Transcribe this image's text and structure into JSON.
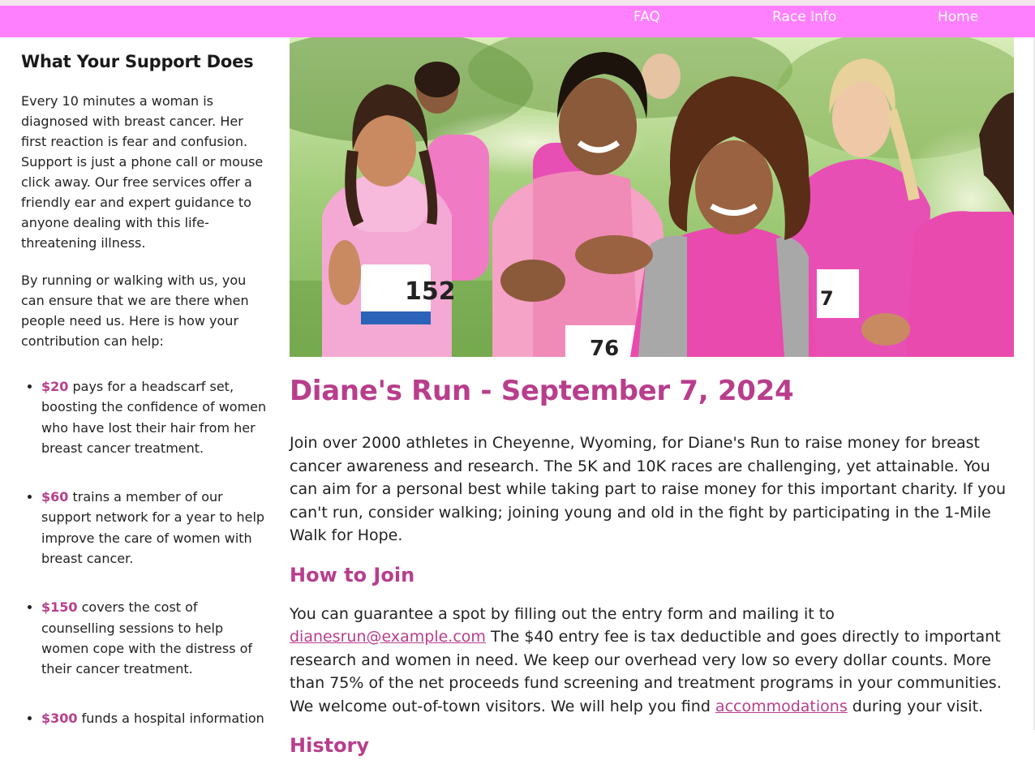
{
  "nav": {
    "items": [
      "FAQ",
      "Race Info",
      "Home"
    ]
  },
  "sidebar": {
    "heading": "What Your Support Does",
    "paragraphs": [
      "Every 10 minutes a woman is diagnosed with breast cancer. Her first reaction is fear and confusion. Support is just a phone call or mouse click away. Our free services offer a friendly ear and expert guidance to anyone dealing with this life-threatening illness.",
      "By running or walking with us, you can ensure that we are there when people need us. Here is how your contribution can help:"
    ],
    "contributions": [
      {
        "amount": "$20",
        "text": " pays for a headscarf set, boosting the confidence of women who have lost their hair from her breast cancer treatment."
      },
      {
        "amount": "$60",
        "text": " trains a member of our support network for a year to help improve the care of women with breast cancer."
      },
      {
        "amount": "$150",
        "text": " covers the cost of counselling sessions to help women cope with the distress of their cancer treatment."
      },
      {
        "amount": "$300",
        "text": " funds a hospital information"
      }
    ]
  },
  "hero": {
    "alt": "Women in pink running a race",
    "bib_numbers": [
      "152",
      "76",
      "7"
    ]
  },
  "main": {
    "title": "Diane's Run - September 7, 2024",
    "intro": "Join over 2000 athletes in Cheyenne, Wyoming, for Diane's Run to raise money for breast cancer awareness and research. The 5K and 10K races are challenging, yet attainable. You can aim for a personal best while taking part to raise money for this important charity. If you can't run, consider walking; joining young and old in the fight by participating in the 1-Mile Walk for Hope.",
    "how_to_join_heading": "How to Join",
    "join_text_before": "You can guarantee a spot by filling out the entry form and mailing it to ",
    "join_email": "dianesrun@example.com",
    "join_text_middle": " The $40 entry fee is tax deductible and goes directly to important research and women in need. We keep our overhead very low so every dollar counts. More than 75% of the net proceeds fund screening and treatment programs in your communities. We welcome out-of-town visitors. We will help you find ",
    "join_link": "accommodations",
    "join_text_after": " during your visit.",
    "history_heading": "History"
  },
  "colors": {
    "nav_bg": "#ff80ff",
    "accent": "#b83e8c"
  }
}
